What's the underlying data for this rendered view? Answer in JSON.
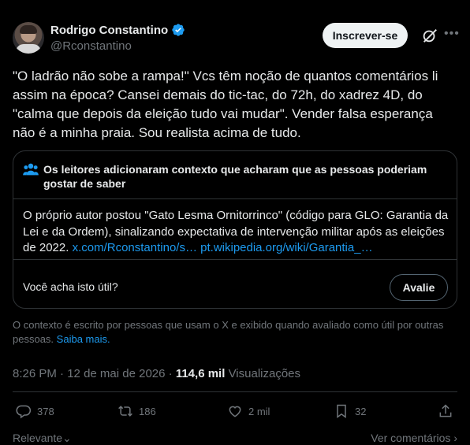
{
  "author": {
    "display_name": "Rodrigo Constantino",
    "handle": "@Rconstantino",
    "verified_icon": "verified-badge-icon",
    "subscribe_label": "Inscrever-se"
  },
  "tweet": {
    "text": "\"O ladrão não sobe a rampa!\" Vcs têm noção de quantos comentários li assim na época? Cansei demais do tic-tac, do 72h, do xadrez 4D, do \"calma que depois da eleição tudo vai mudar\". Vender falsa esperança não é a minha praia. Sou realista acima de tudo."
  },
  "community_note": {
    "title": "Os leitores adicionaram contexto que acharam que as pessoas poderiam gostar de saber",
    "body": "O próprio autor postou \"Gato Lesma Ornitorrinco\" (código para GLO: Garantia da Lei e da Ordem), sinalizando expectativa de intervenção militar após as eleições de 2022.",
    "link1": "x.com/Rconstantino/s…",
    "link2": "pt.wikipedia.org/wiki/Garantia_…",
    "useful_question": "Você acha isto útil?",
    "rate_label": "Avalie",
    "footer_text": "O contexto é escrito por pessoas que usam o X e exibido quando avaliado como útil por outras pessoas.",
    "learn_more": "Saiba mais."
  },
  "meta": {
    "time": "8:26 PM",
    "separator": "·",
    "date": "12 de mai de 2026",
    "views_count": "114,6 mil",
    "views_label": "Visualizações"
  },
  "actions": {
    "replies": "378",
    "reposts": "186",
    "likes": "2 mil",
    "bookmarks": "32"
  },
  "bottom": {
    "sort_label": "Relevante",
    "view_comments": "Ver comentários"
  },
  "colors": {
    "background": "#000000",
    "text": "#e7e9ea",
    "muted": "#71767b",
    "accent": "#1d9bf0",
    "border": "#2f3336"
  }
}
